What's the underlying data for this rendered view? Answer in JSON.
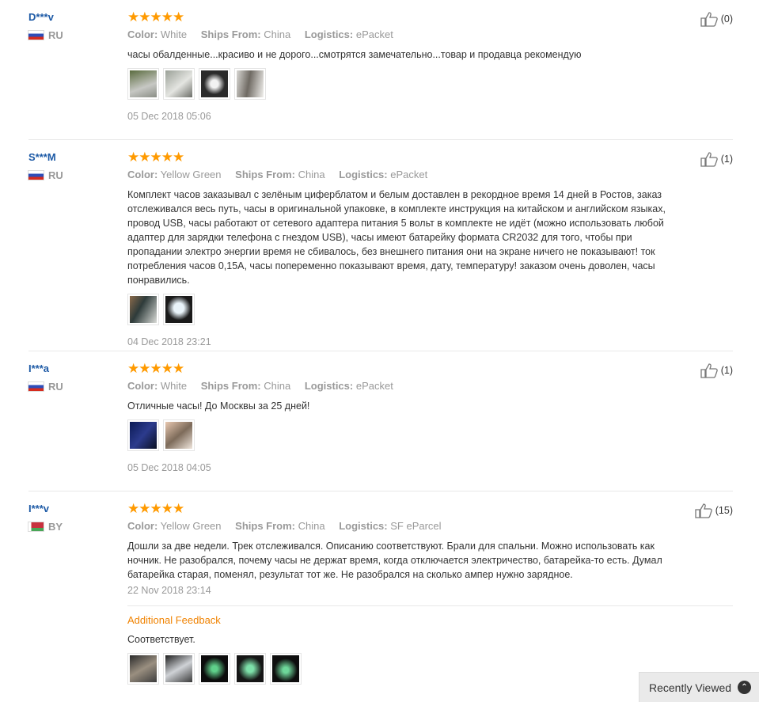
{
  "attr_keys": {
    "color": "Color:",
    "ships_from": "Ships From:",
    "logistics": "Logistics:"
  },
  "stars": "★★★★★",
  "reviews": [
    {
      "user": "D***v",
      "country": "RU",
      "color": "White",
      "ships_from": "China",
      "logistics": "ePacket",
      "text": "часы обалденные...красиво и не дорого...смотрятся замечательно...товар и продавца рекомендую",
      "date": "05 Dec 2018 05:06",
      "helpful": "(0)"
    },
    {
      "user": "S***M",
      "country": "RU",
      "color": "Yellow Green",
      "ships_from": "China",
      "logistics": "ePacket",
      "text": "Комплект часов заказывал с зелёным циферблатом и белым доставлен в рекордное время 14 дней в Ростов, заказ отслеживался весь путь, часы в оригинальной упаковке, в комплекте инструкция на китайском и английском языках, провод USB, часы работают от сетевого адаптера питания 5 вольт в комплекте не идёт (можно использовать любой адаптер для зарядки телефона с гнездом USB), часы имеют батарейку формата CR2032 для того, чтобы при пропадании электро энергии время не сбивалось, без внешнего питания они на экране ничего не показывают! ток потребления часов 0,15А, часы попеременно показывают время, дату, температуру! заказом очень доволен, часы понравились.",
      "date": "04 Dec 2018 23:21",
      "helpful": "(1)"
    },
    {
      "user": "I***a",
      "country": "RU",
      "color": "White",
      "ships_from": "China",
      "logistics": "ePacket",
      "text": "Отличные часы! До Москвы за 25 дней!",
      "date": "05 Dec 2018 04:05",
      "helpful": "(1)"
    },
    {
      "user": "I***v",
      "country": "BY",
      "color": "Yellow Green",
      "ships_from": "China",
      "logistics": "SF eParcel",
      "text": "Дошли за две недели. Трек отслеживался. Описанию соответствуют. Брали для спальни. Можно использовать как ночник. Не разобрался, почему часы не держат время, когда отключается электричество, батарейка-то есть. Думал батарейка старая, поменял, результат тот же. Не разобрался на сколько ампер нужно зарядное.",
      "date": "22 Nov 2018 23:14",
      "helpful": "(15)",
      "additional_title": "Additional Feedback",
      "additional_text": "Соответствует."
    }
  ],
  "recently_viewed": "Recently Viewed"
}
